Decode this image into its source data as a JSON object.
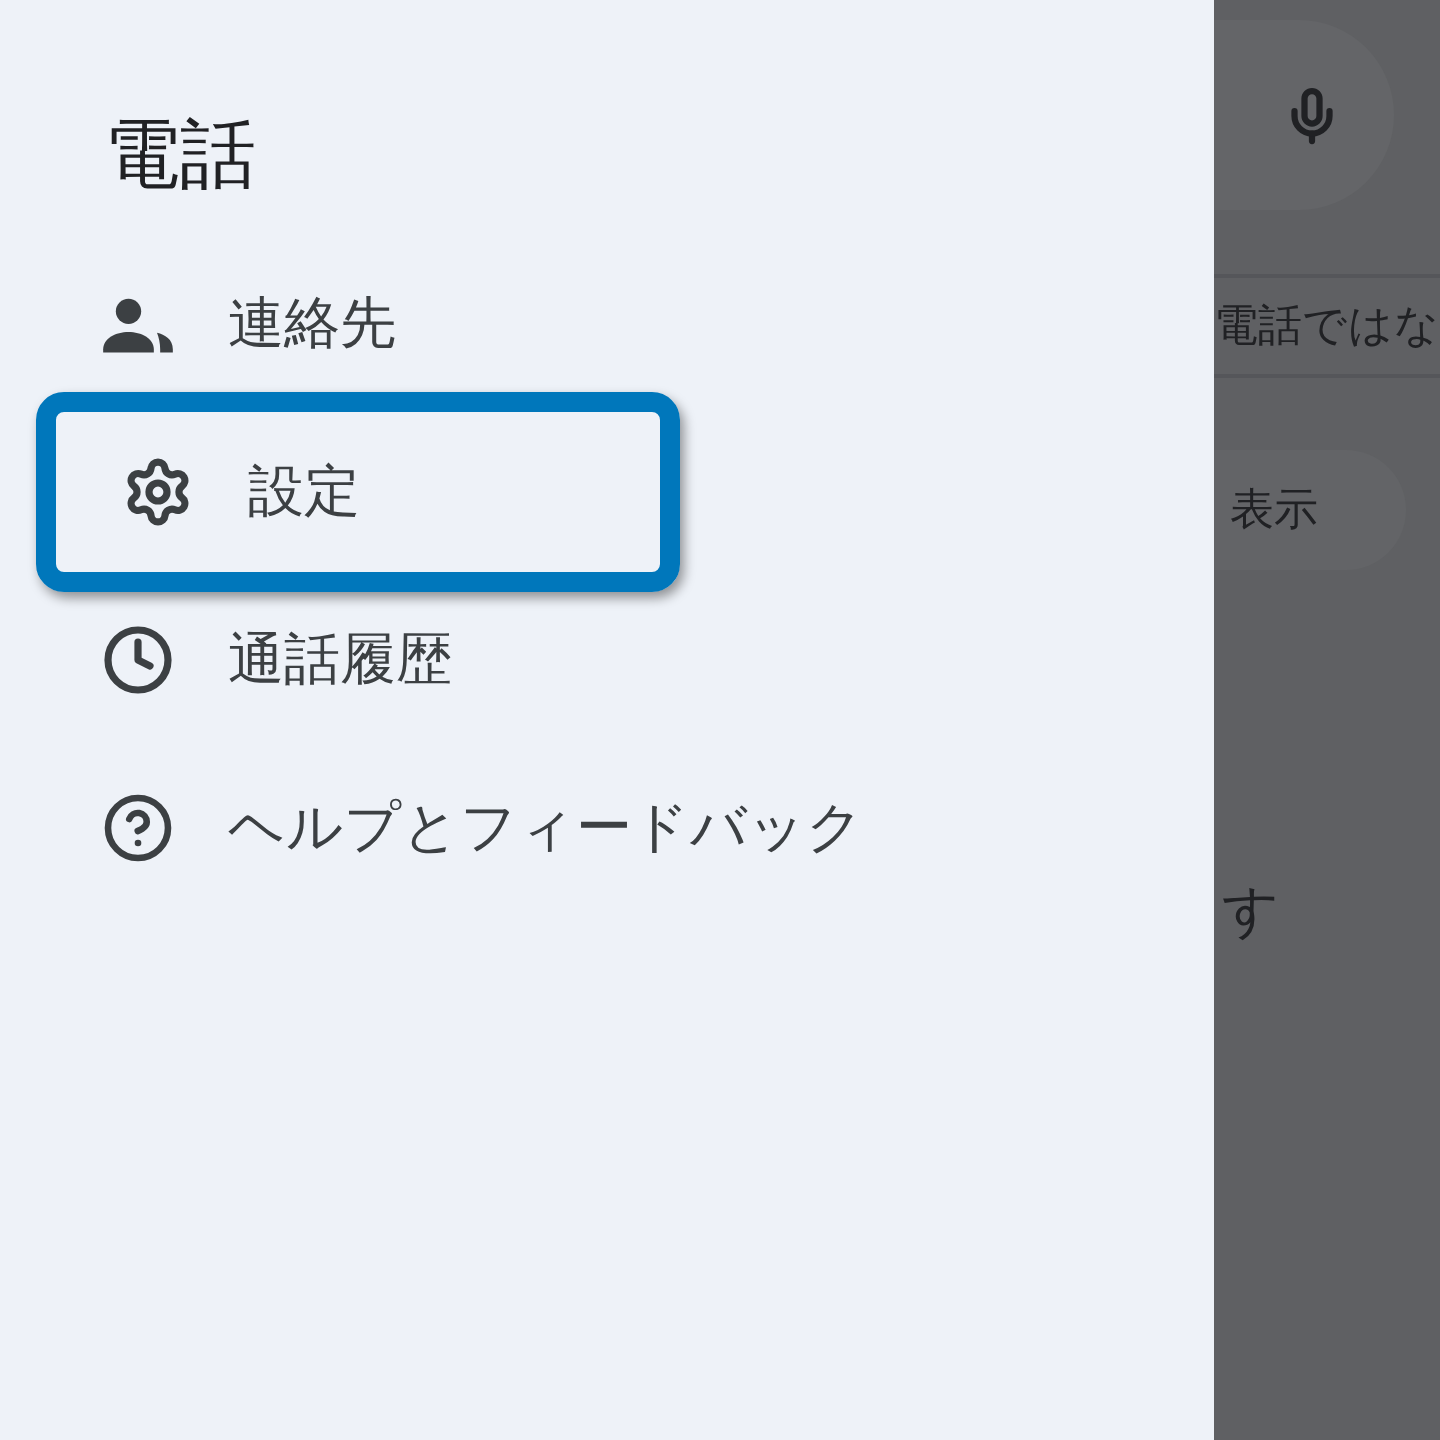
{
  "drawer": {
    "title": "電話",
    "items": [
      {
        "label": "連絡先",
        "highlighted": false
      },
      {
        "label": "設定",
        "highlighted": true
      },
      {
        "label": "通話履歴",
        "highlighted": false
      },
      {
        "label": "ヘルプとフィードバック",
        "highlighted": false
      }
    ]
  },
  "background": {
    "banner": "電話ではな",
    "chip": "表示",
    "message": "す"
  }
}
